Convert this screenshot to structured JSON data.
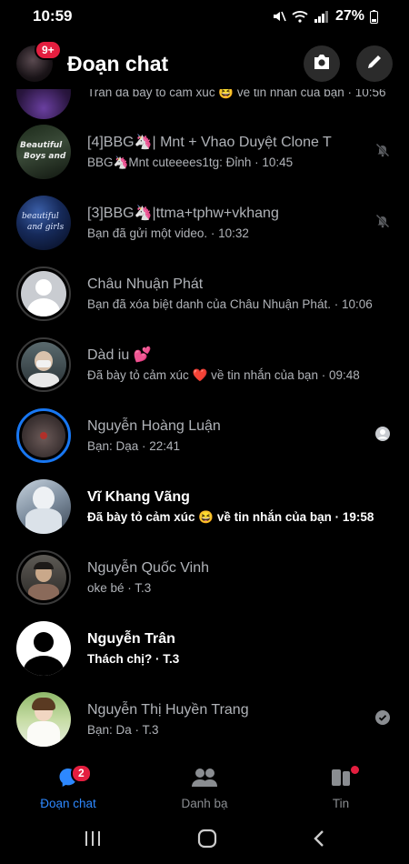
{
  "status": {
    "time": "10:59",
    "battery": "27%"
  },
  "header": {
    "title": "Đoạn chat",
    "badge": "9+"
  },
  "chats": [
    {
      "name": "",
      "message": "Trân đã bày tỏ cảm xúc 😆 về tin nhắn của bạn · 10:56",
      "unread": false,
      "right": "none"
    },
    {
      "name": "[4]BBG🦄| Mnt + Vhao Duyệt Clone T",
      "message": "BBG🦄Mnt cuteeees1tg: Đỉnh · 10:45",
      "unread": false,
      "right": "muted"
    },
    {
      "name": "[3]BBG🦄|ttma+tphw+vkhang",
      "message": "Bạn đã gửi một video. · 10:32",
      "unread": false,
      "right": "muted"
    },
    {
      "name": "Châu Nhuận Phát",
      "message": "Bạn đã xóa biệt danh của Châu Nhuận Phát. · 10:06",
      "unread": false,
      "right": "none"
    },
    {
      "name": "Dàd iu 💕",
      "message": "Đã bày tỏ cảm xúc ❤️ về tin nhắn của bạn · 09:48",
      "unread": false,
      "right": "none"
    },
    {
      "name": "Nguyễn Hoàng Luận",
      "message": "Bạn: Dạa · 22:41",
      "unread": false,
      "right": "seen"
    },
    {
      "name": "Vĩ Khang Vãng",
      "message": "Đã bày tỏ cảm xúc 😆 về tin nhắn của bạn · 19:58",
      "unread": true,
      "right": "none"
    },
    {
      "name": "Nguyễn Quốc Vinh",
      "message": "oke bé · T.3",
      "unread": false,
      "right": "none"
    },
    {
      "name": "Nguyễn Trân",
      "message": "Thách chị? · T.3",
      "unread": true,
      "right": "none"
    },
    {
      "name": "Nguyễn Thị Huyền Trang",
      "message": "Bạn: Da · T.3",
      "unread": false,
      "right": "delivered"
    }
  ],
  "nav": {
    "chats_label": "Đoạn chat",
    "chats_badge": "2",
    "contacts_label": "Danh bạ",
    "stories_label": "Tin"
  },
  "colors": {
    "accent": "#2d88ff",
    "badge": "#e41e3f",
    "background": "#000000"
  }
}
